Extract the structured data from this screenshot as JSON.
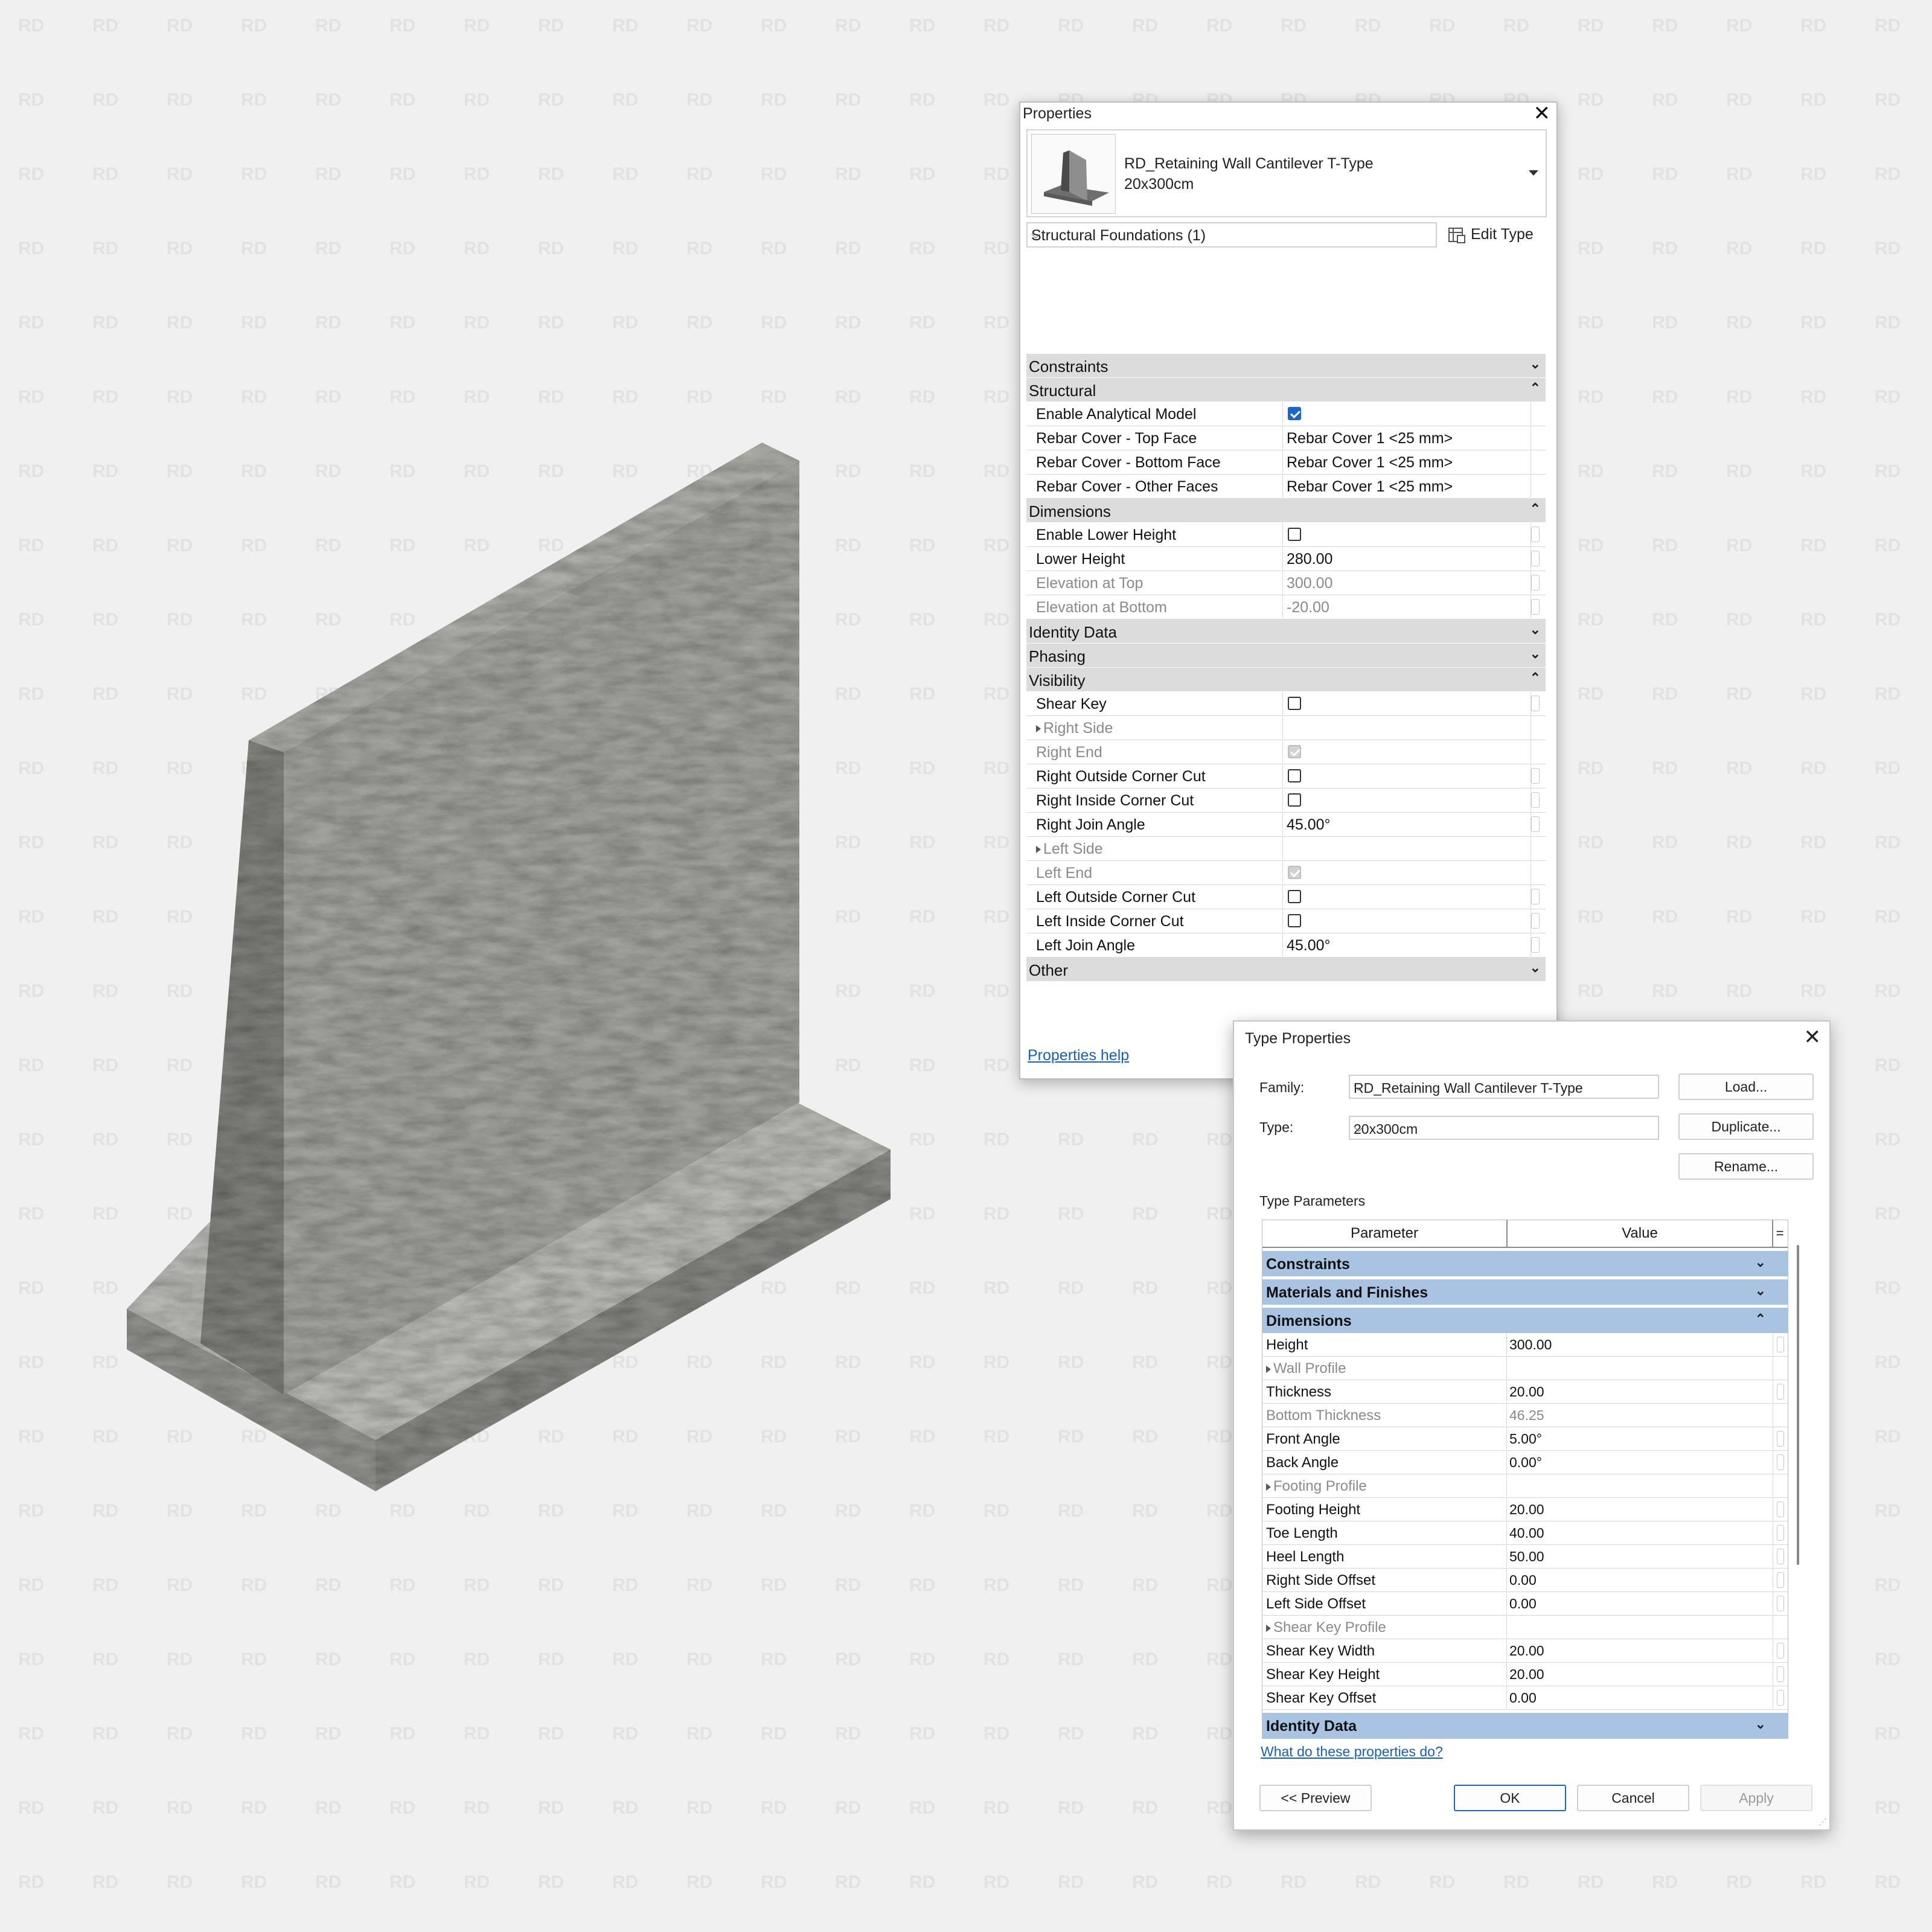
{
  "watermark": {
    "text": "RD"
  },
  "model": {
    "name": "concrete-retaining-wall-3d"
  },
  "properties": {
    "title": "Properties",
    "close_glyph": "✕",
    "type_name_line1": "RD_Retaining Wall Cantilever T-Type",
    "type_name_line2": "20x300cm",
    "filter_value": "Structural Foundations (1)",
    "edit_type_label": "Edit Type",
    "help_link": "Properties help",
    "rows": [
      {
        "kind": "cat",
        "label": "Constraints",
        "state": "collapsed"
      },
      {
        "kind": "cat",
        "label": "Structural",
        "state": "expanded"
      },
      {
        "kind": "prm",
        "label": "Enable Analytical Model",
        "check": "on"
      },
      {
        "kind": "prm",
        "label": "Rebar Cover - Top Face",
        "value": "Rebar Cover 1 <25 mm>"
      },
      {
        "kind": "prm",
        "label": "Rebar Cover - Bottom Face",
        "value": "Rebar Cover 1 <25 mm>"
      },
      {
        "kind": "prm",
        "label": "Rebar Cover - Other Faces",
        "value": "Rebar Cover 1 <25 mm>"
      },
      {
        "kind": "cat",
        "label": "Dimensions",
        "state": "expanded"
      },
      {
        "kind": "prm",
        "label": "Enable Lower Height",
        "check": "off",
        "dot": true
      },
      {
        "kind": "prm",
        "label": "Lower Height",
        "value": "280.00",
        "dot": true
      },
      {
        "kind": "prm",
        "label": "Elevation at Top",
        "value": "300.00",
        "dim": true,
        "dot": true
      },
      {
        "kind": "prm",
        "label": "Elevation at Bottom",
        "value": "-20.00",
        "dim": true,
        "dot": true
      },
      {
        "kind": "cat",
        "label": "Identity Data",
        "state": "collapsed"
      },
      {
        "kind": "cat",
        "label": "Phasing",
        "state": "collapsed"
      },
      {
        "kind": "cat",
        "label": "Visibility",
        "state": "expanded"
      },
      {
        "kind": "prm",
        "label": "Shear Key",
        "check": "off",
        "dot": true
      },
      {
        "kind": "prm",
        "label": "Right Side",
        "group": true,
        "dim": true
      },
      {
        "kind": "prm",
        "label": "Right End",
        "check": "grey",
        "dim": true
      },
      {
        "kind": "prm",
        "label": "Right Outside Corner Cut",
        "check": "off",
        "dot": true
      },
      {
        "kind": "prm",
        "label": "Right Inside Corner Cut",
        "check": "off",
        "dot": true
      },
      {
        "kind": "prm",
        "label": "Right Join Angle",
        "value": "45.00°",
        "dot": true
      },
      {
        "kind": "prm",
        "label": "Left Side",
        "group": true,
        "dim": true
      },
      {
        "kind": "prm",
        "label": "Left End",
        "check": "grey",
        "dim": true
      },
      {
        "kind": "prm",
        "label": "Left Outside Corner Cut",
        "check": "off",
        "dot": true
      },
      {
        "kind": "prm",
        "label": "Left Inside Corner Cut",
        "check": "off",
        "dot": true
      },
      {
        "kind": "prm",
        "label": "Left Join Angle",
        "value": "45.00°",
        "dot": true
      },
      {
        "kind": "cat",
        "label": "Other",
        "state": "collapsed"
      }
    ]
  },
  "type_properties": {
    "title": "Type Properties",
    "close_glyph": "✕",
    "family_label": "Family:",
    "family_value": "RD_Retaining Wall Cantilever T-Type",
    "type_label": "Type:",
    "type_value": "20x300cm",
    "load_button": "Load...",
    "duplicate_button": "Duplicate...",
    "rename_button": "Rename...",
    "section_label": "Type Parameters",
    "col_parameter": "Parameter",
    "col_value": "Value",
    "col_eq": "=",
    "rows": [
      {
        "kind": "cat",
        "label": "Constraints",
        "state": "collapsed"
      },
      {
        "kind": "cat",
        "label": "Materials and Finishes",
        "state": "collapsed"
      },
      {
        "kind": "cat",
        "label": "Dimensions",
        "state": "expanded"
      },
      {
        "kind": "prm",
        "label": "Height",
        "value": "300.00",
        "dot": true
      },
      {
        "kind": "prm",
        "label": "Wall Profile",
        "group": true,
        "dim": true
      },
      {
        "kind": "prm",
        "label": "Thickness",
        "value": "20.00",
        "dot": true
      },
      {
        "kind": "prm",
        "label": "Bottom Thickness",
        "value": "46.25",
        "dim": true
      },
      {
        "kind": "prm",
        "label": "Front Angle",
        "value": "5.00°",
        "dot": true
      },
      {
        "kind": "prm",
        "label": "Back Angle",
        "value": "0.00°",
        "dot": true
      },
      {
        "kind": "prm",
        "label": "Footing Profile",
        "group": true,
        "dim": true
      },
      {
        "kind": "prm",
        "label": "Footing Height",
        "value": "20.00",
        "dot": true
      },
      {
        "kind": "prm",
        "label": "Toe Length",
        "value": "40.00",
        "dot": true
      },
      {
        "kind": "prm",
        "label": "Heel Length",
        "value": "50.00",
        "dot": true
      },
      {
        "kind": "prm",
        "label": "Right Side Offset",
        "value": "0.00",
        "dot": true
      },
      {
        "kind": "prm",
        "label": "Left Side Offset",
        "value": "0.00",
        "dot": true
      },
      {
        "kind": "prm",
        "label": "Shear Key Profile",
        "group": true,
        "dim": true
      },
      {
        "kind": "prm",
        "label": "Shear Key Width",
        "value": "20.00",
        "dot": true
      },
      {
        "kind": "prm",
        "label": "Shear Key Height",
        "value": "20.00",
        "dot": true
      },
      {
        "kind": "prm",
        "label": "Shear Key Offset",
        "value": "0.00",
        "dot": true
      },
      {
        "kind": "cat",
        "label": "Identity Data",
        "state": "collapsed"
      }
    ],
    "help_link": "What do these properties do?",
    "preview_button": "<< Preview",
    "ok_button": "OK",
    "cancel_button": "Cancel",
    "apply_button": "Apply"
  }
}
